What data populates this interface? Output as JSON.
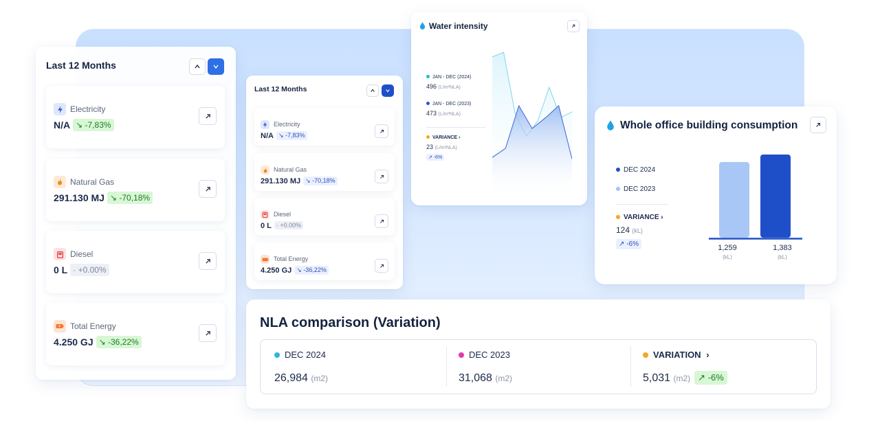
{
  "energy_card_large": {
    "title": "Last 12 Months",
    "items": [
      {
        "label": "Electricity",
        "value": "N/A",
        "change": "-7,83%"
      },
      {
        "label": "Natural Gas",
        "value": "291.130 MJ",
        "change": "-70,18%"
      },
      {
        "label": "Diesel",
        "value": "0 L",
        "change": "+0.00%"
      },
      {
        "label": "Total Energy",
        "value": "4.250 GJ",
        "change": "-36,22%"
      }
    ]
  },
  "energy_card_small": {
    "title": "Last 12 Months",
    "items": [
      {
        "label": "Electricity",
        "value": "N/A",
        "change": "-7,83%"
      },
      {
        "label": "Natural Gas",
        "value": "291.130 MJ",
        "change": "-70,18%"
      },
      {
        "label": "Diesel",
        "value": "0 L",
        "change": "+0.00%"
      },
      {
        "label": "Total Energy",
        "value": "4.250 GJ",
        "change": "-36,22%"
      }
    ]
  },
  "water_intensity": {
    "title": "Water intensity",
    "legend": [
      {
        "label": "JAN - DEC (2024)",
        "value": "496",
        "unit": "(L/m²NLA)",
        "color": "#17c1c9"
      },
      {
        "label": "JAN - DEC (2023)",
        "value": "473",
        "unit": "(L/m²NLA)",
        "color": "#2f55d4"
      }
    ],
    "variance": {
      "label": "VARIANCE",
      "value": "23",
      "unit": "(L/m²NLA)",
      "change": "-6%",
      "color": "#f5a623"
    }
  },
  "building_consumption": {
    "title": "Whole office building consumption",
    "legend": [
      {
        "label": "DEC 2024",
        "color": "#1f4fc8"
      },
      {
        "label": "DEC 2023",
        "color": "#9fc3f6"
      }
    ],
    "variance": {
      "label": "VARIANCE",
      "value": "124",
      "unit": "(kL)",
      "change": "-6%",
      "color": "#f5a623"
    },
    "bars": [
      {
        "value_label": "1,259",
        "unit": "(kL)"
      },
      {
        "value_label": "1,383",
        "unit": "(kL)"
      }
    ]
  },
  "chart_data": [
    {
      "type": "area",
      "title": "Water intensity",
      "series": [
        {
          "name": "JAN - DEC (2024)",
          "values": [
            0.92,
            0.95,
            0.55,
            0.4,
            0.5,
            0.72,
            0.52,
            0.56
          ]
        },
        {
          "name": "JAN - DEC (2023)",
          "values": [
            0.26,
            0.32,
            0.6,
            0.45,
            0.52,
            0.6,
            0.25
          ]
        }
      ]
    },
    {
      "type": "bar",
      "title": "Whole office building consumption",
      "categories": [
        "DEC 2023",
        "DEC 2024"
      ],
      "values": [
        1259,
        1383
      ],
      "ylabel": "(kL)"
    }
  ],
  "nla": {
    "title": "NLA comparison (Variation)",
    "columns": [
      {
        "label": "DEC 2024",
        "value": "26,984",
        "unit": "(m2)",
        "color": "#2fb6e0"
      },
      {
        "label": "DEC 2023",
        "value": "31,068",
        "unit": "(m2)",
        "color": "#e23aa8"
      },
      {
        "label": "VARIATION",
        "value": "5,031",
        "unit": "(m2)",
        "change": "-6%",
        "color": "#f5a623"
      }
    ]
  }
}
